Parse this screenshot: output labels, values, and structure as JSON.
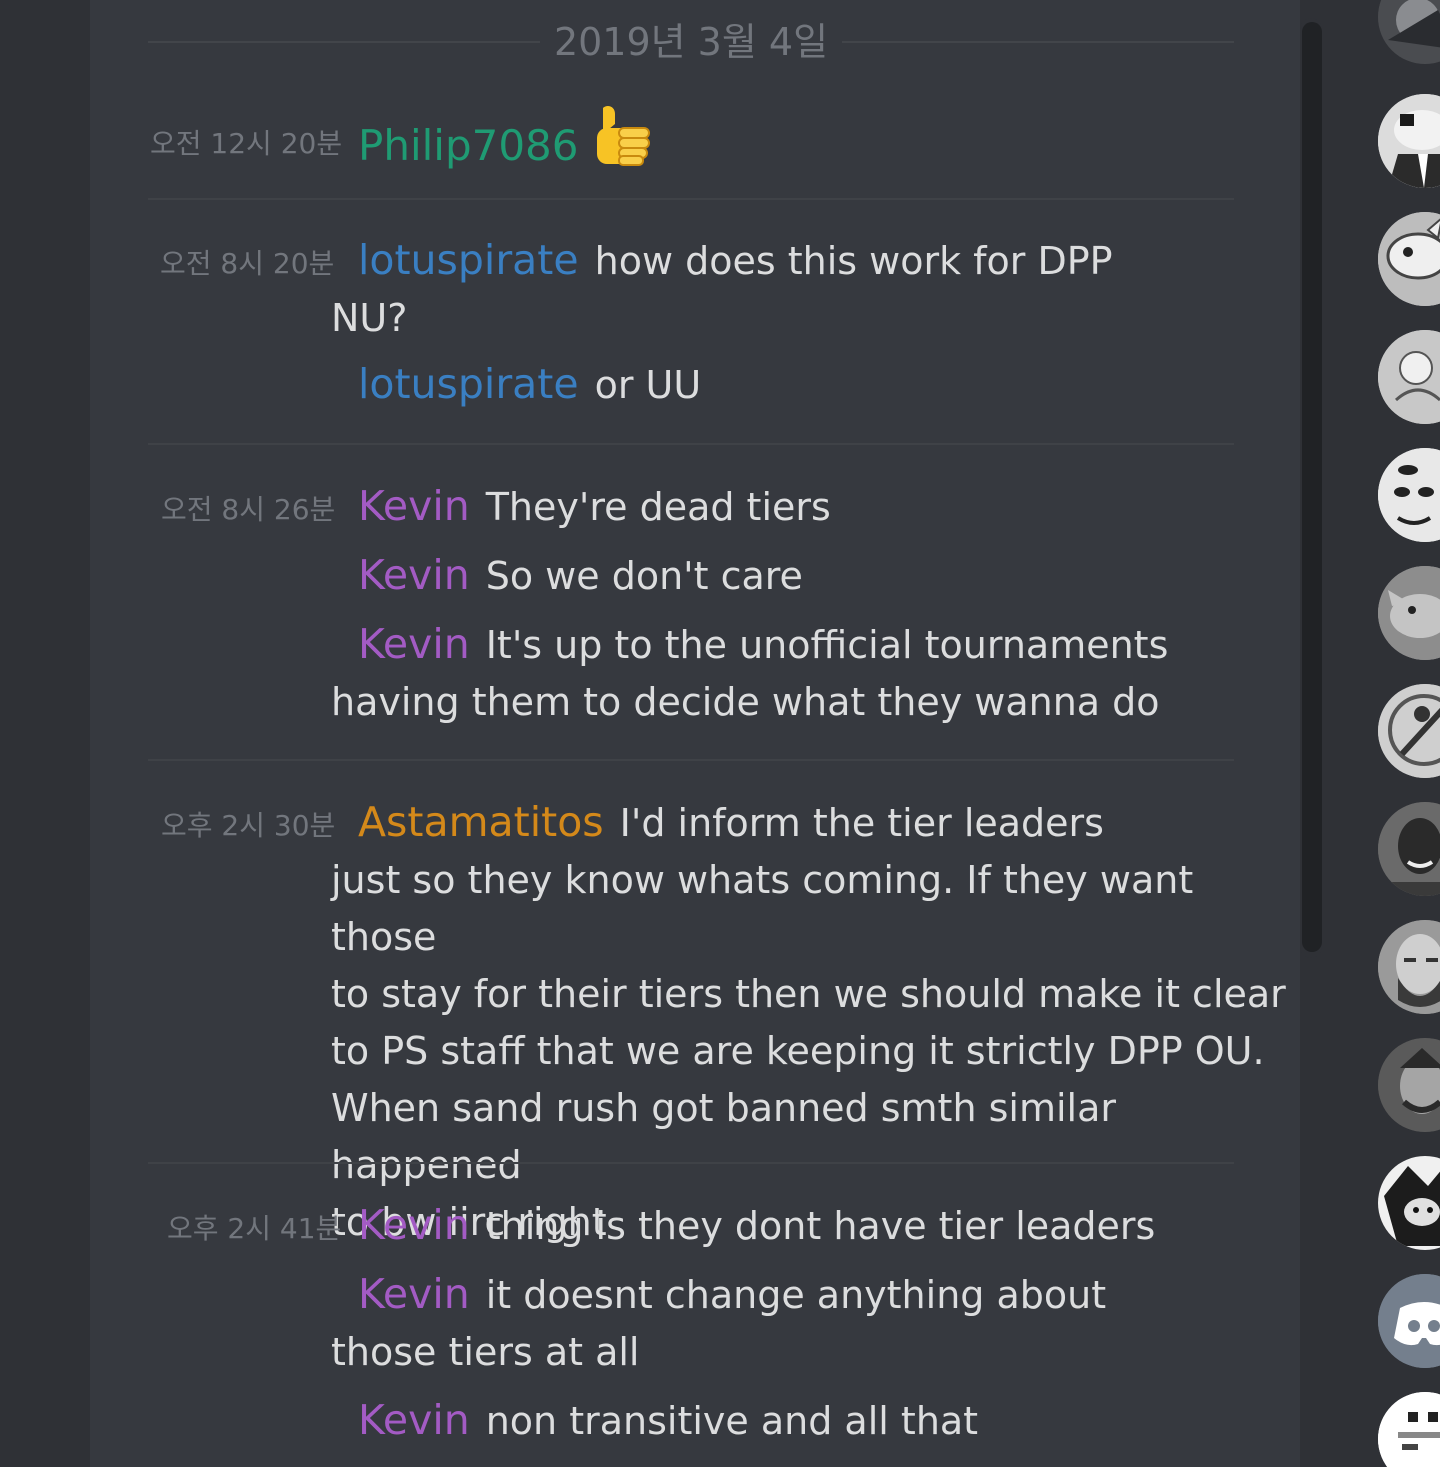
{
  "date_divider": "2019년 3월 4일",
  "colors": {
    "philip": "#1f9b73",
    "lotus": "#3a7fc2",
    "kevin": "#a35bc4",
    "astamatitos": "#d4891a"
  },
  "groups": [
    {
      "timestamp": "오전 12시 20분",
      "messages": [
        {
          "author": "Philip7086",
          "text": "",
          "emoji": "thumbs-up"
        }
      ]
    },
    {
      "timestamp": "오전 8시 20분",
      "messages": [
        {
          "author": "lotuspirate",
          "text_line1": "how does this work for DPP",
          "text_line2": "NU?"
        },
        {
          "author": "lotuspirate",
          "text": "or UU"
        }
      ]
    },
    {
      "timestamp": "오전 8시 26분",
      "messages": [
        {
          "author": "Kevin",
          "text": "They're dead tiers"
        },
        {
          "author": "Kevin",
          "text": "So we don't care"
        },
        {
          "author": "Kevin",
          "text_line1": "It's up to the unofficial tournaments",
          "text_line2": "having them to decide what they wanna do"
        }
      ]
    },
    {
      "timestamp": "오후 2시 30분",
      "messages": [
        {
          "author": "Astamatitos",
          "text_line1": "I'd inform the tier leaders",
          "lines": [
            "just so they know whats coming. If they want those",
            "to stay for their tiers then we should make it clear",
            "to PS staff that we are keeping it strictly DPP OU.",
            "When sand rush got banned smth similar happened",
            "to bw iirc right"
          ]
        }
      ]
    },
    {
      "timestamp": "오후 2시 41분",
      "messages": [
        {
          "author": "Kevin",
          "text": "thing is they dont have tier leaders"
        },
        {
          "author": "Kevin",
          "text_line1": "it doesnt change anything about",
          "text_line2": "those tiers at all"
        },
        {
          "author": "Kevin",
          "text": "non transitive and all that"
        }
      ]
    }
  ],
  "member_avatars": [
    "avatar-1",
    "avatar-2",
    "avatar-3",
    "avatar-4",
    "avatar-5",
    "avatar-6",
    "avatar-7",
    "avatar-8",
    "avatar-9",
    "avatar-10",
    "avatar-11",
    "discord-logo-avatar",
    "avatar-13"
  ]
}
